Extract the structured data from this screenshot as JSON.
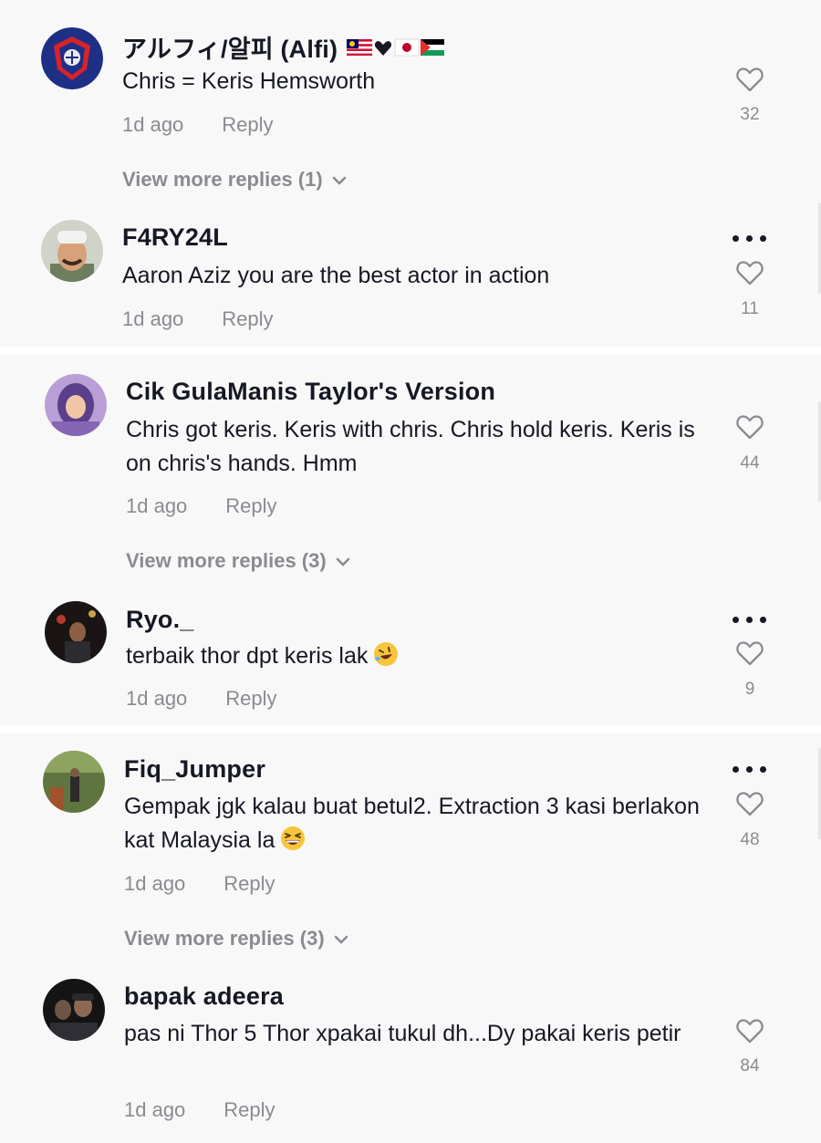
{
  "comments": [
    {
      "username": "アルフィ/알피 (Alfi)",
      "text": "Chris = Keris Hemsworth",
      "time": "1d ago",
      "reply_label": "Reply",
      "likes": "32",
      "view_more": "View more replies (1)",
      "flags": [
        "malaysia-flag-icon",
        "heart-icon",
        "japan-flag-icon",
        "palestine-flag-icon"
      ]
    },
    {
      "username": "F4RY24L",
      "text": "Aaron Aziz you are the best actor in action",
      "time": "1d ago",
      "reply_label": "Reply",
      "likes": "11"
    },
    {
      "username": "Cik  GulaManis  Taylor's  Version",
      "text": "Chris got keris. Keris with chris. Chris hold keris. Keris is on chris's hands. Hmm",
      "time": "1d ago",
      "reply_label": "Reply",
      "likes": "44",
      "view_more": "View more replies (3)"
    },
    {
      "username": "Ryo._",
      "text": "terbaik thor dpt keris lak",
      "emoji": "rolling-laughing-emoji",
      "time": "1d ago",
      "reply_label": "Reply",
      "likes": "9"
    },
    {
      "username": "Fiq_Jumper",
      "text": "Gempak jgk kalau buat betul2. Extraction 3 kasi berlakon kat Malaysia la",
      "emoji": "grinning-squint-emoji",
      "time": "1d ago",
      "reply_label": "Reply",
      "likes": "48",
      "view_more": "View more replies (3)"
    },
    {
      "username": "bapak adeera",
      "text": "pas ni Thor 5 Thor xpakai tukul dh...Dy pakai keris petir",
      "time": "1d ago",
      "reply_label": "Reply",
      "likes": "84"
    }
  ],
  "colors": {
    "background": "#f8f8f8",
    "primary_text": "#161823",
    "secondary_text": "#8a8b91"
  }
}
